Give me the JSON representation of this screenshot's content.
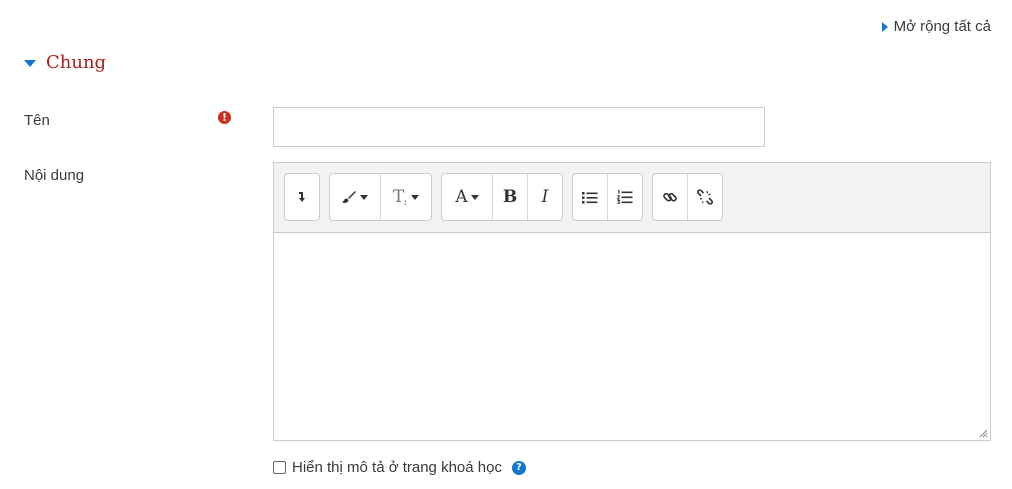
{
  "expand_all": {
    "label": "Mở rộng tất cả",
    "icon": "caret-right-icon"
  },
  "section": {
    "title": "Chung",
    "icon": "caret-down-icon"
  },
  "fields": {
    "name": {
      "label": "Tên",
      "value": "",
      "required_icon": "exclamation-circle-icon"
    },
    "content": {
      "label": "Nội dung",
      "value": ""
    }
  },
  "editor_toolbar": {
    "groups": [
      [
        "collapse-toolbar-icon"
      ],
      [
        "paintbrush-style-icon",
        "clear-formatting-icon"
      ],
      [
        "font-color-icon",
        "bold-icon",
        "italic-icon"
      ],
      [
        "unordered-list-icon",
        "ordered-list-icon"
      ],
      [
        "link-icon",
        "unlink-icon"
      ]
    ],
    "glyphs": {
      "text_style": "T",
      "font": "A",
      "bold": "B",
      "italic": "I"
    }
  },
  "show_description": {
    "label": "Hiển thị mô tả ở trang khoá học",
    "checked": false,
    "help_icon": "question-circle-icon"
  },
  "colors": {
    "accent": "#1177d1",
    "section_title": "#b01b1b",
    "required": "#ca3120"
  }
}
